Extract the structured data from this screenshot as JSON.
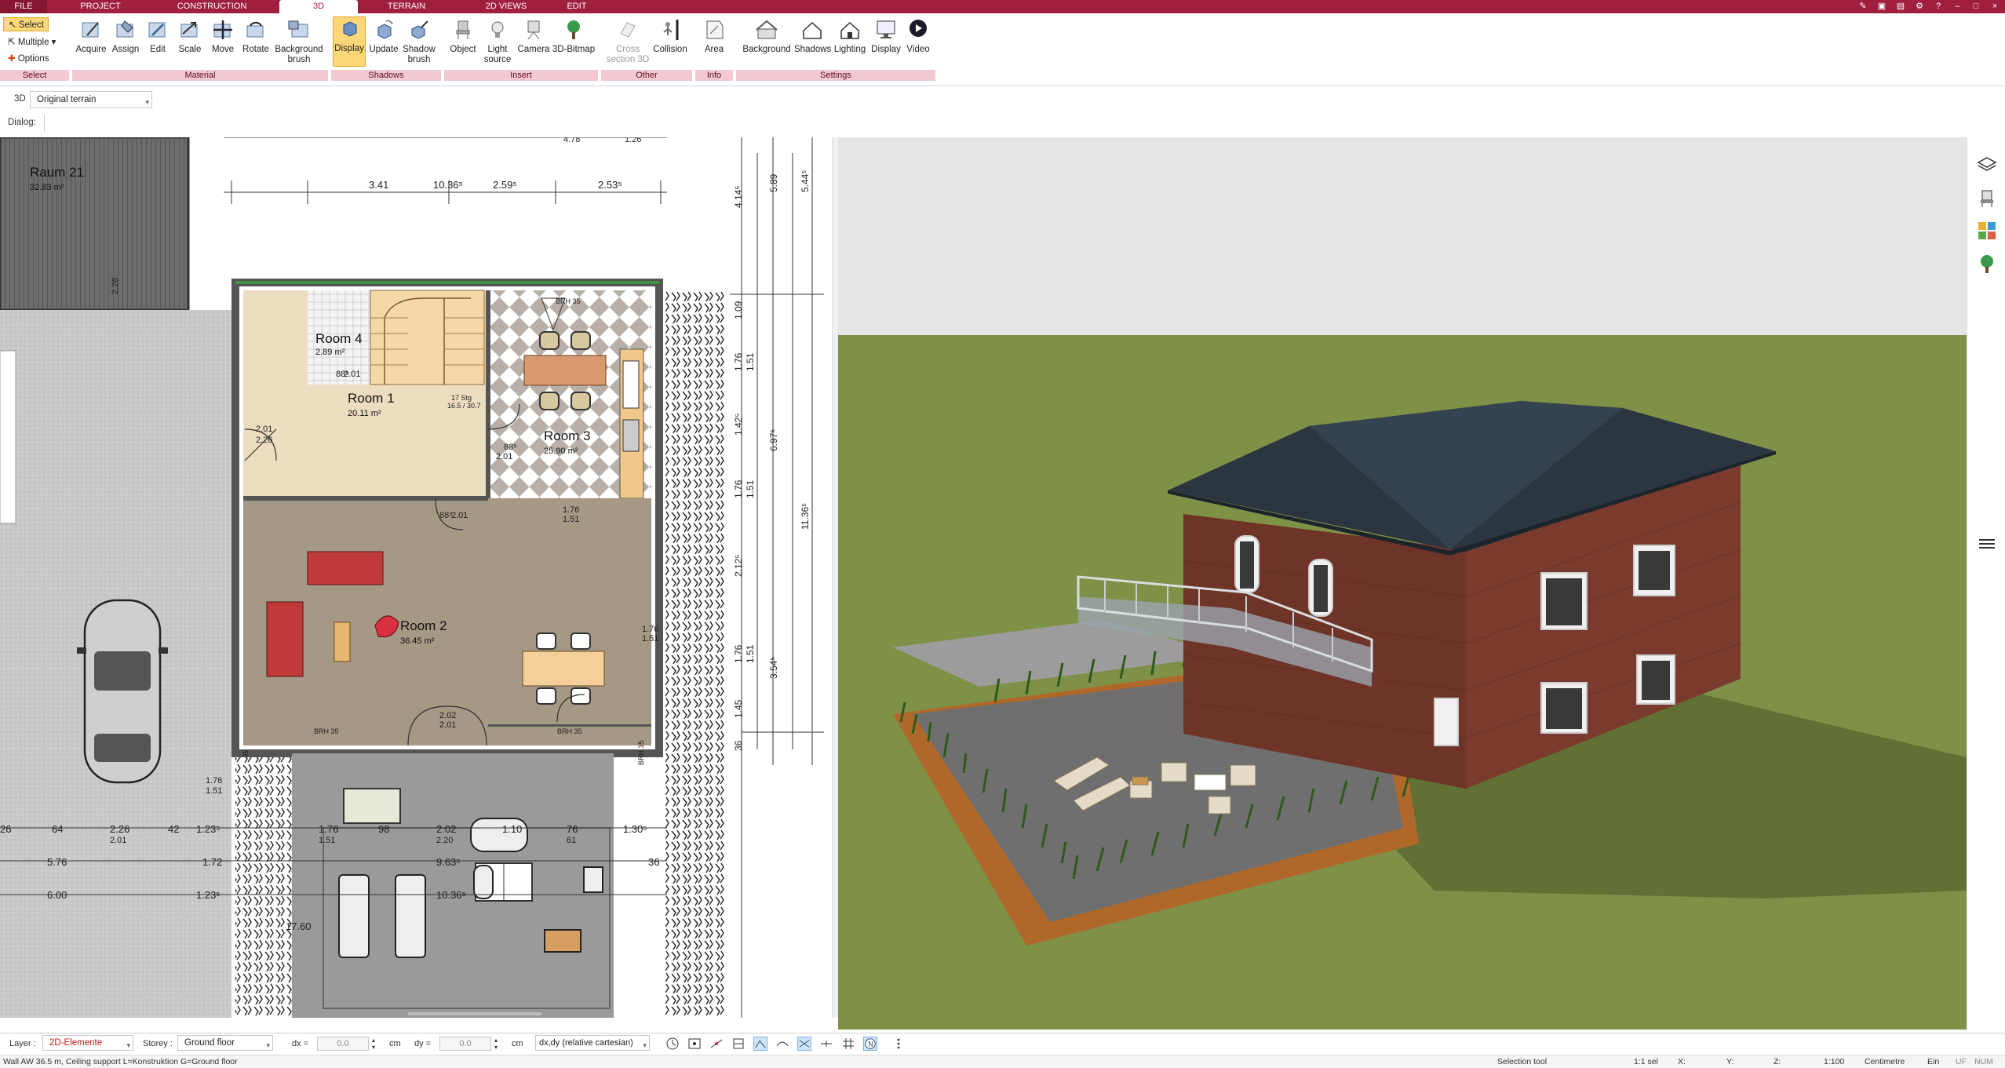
{
  "menu": {
    "file": "FILE",
    "tabs": [
      "PROJECT",
      "CONSTRUCTION",
      "3D",
      "TERRAIN",
      "2D VIEWS",
      "EDIT"
    ],
    "active_tab": "3D"
  },
  "ribbon": {
    "select": {
      "select_label": "Select",
      "multiple_label": "Multiple",
      "options_label": "Options",
      "group": "Select"
    },
    "material": {
      "buttons": [
        "Acquire",
        "Assign",
        "Edit",
        "Scale",
        "Move",
        "Rotate",
        "Background brush"
      ],
      "group": "Material"
    },
    "shadows": {
      "buttons": [
        "Display",
        "Update",
        "Shadow brush"
      ],
      "selected": "Display",
      "group": "Shadows"
    },
    "insert": {
      "buttons": [
        "Object",
        "Light source",
        "Camera",
        "3D-Bitmap"
      ],
      "group": "Insert"
    },
    "other": {
      "buttons": [
        "Cross section 3D",
        "Collision"
      ],
      "disabled": "Cross section 3D",
      "group": "Other"
    },
    "info": {
      "buttons": [
        "Area"
      ],
      "group": "Info"
    },
    "settings": {
      "buttons": [
        "Background",
        "Shadows",
        "Lighting",
        "Display",
        "Video"
      ],
      "group": "Settings"
    }
  },
  "view_bar": {
    "mode": "3D",
    "terrain_select": "Original terrain",
    "dialog_label": "Dialog:"
  },
  "plan": {
    "rooms": [
      {
        "name": "Raum 21",
        "area": "32.83 m²"
      },
      {
        "name": "Room 4",
        "area": "2.89 m²"
      },
      {
        "name": "Room 1",
        "area": "20.11 m²"
      },
      {
        "name": "Room 3",
        "area": "25.90 m²"
      },
      {
        "name": "Room 2",
        "area": "36.45 m²"
      }
    ],
    "dims_top": [
      "3.41",
      "10.36⁵",
      "2.59⁵",
      "2.53⁵",
      "4.78",
      "1.26"
    ],
    "dims_right_inner": [
      "1.09",
      "1.76",
      "1.51",
      "1.42⁵",
      "1.76",
      "1.51",
      "2.12⁵",
      "1.76",
      "1.51",
      "1.45",
      "36"
    ],
    "dims_right_outer": [
      "5.89",
      "4.14⁵",
      "6.97⁵",
      "3.54⁵",
      "11.36⁵",
      "5.44⁵"
    ],
    "dims_misc": [
      "2.01",
      "2.26",
      "88⁵",
      "2.01",
      "88⁵",
      "2.01",
      "88⁵",
      "2.01",
      "17 Stg",
      "16.5 / 30.7",
      "1.76",
      "1.51",
      "2.02",
      "2.01",
      "1.76",
      "1.51",
      "1.76",
      "1.51"
    ],
    "brh_labels": [
      "BRH 35",
      "BRH 35",
      "BRH 35",
      "BRH 35",
      "BRH 35"
    ],
    "dims_bottom_row1": [
      "26",
      "64",
      "2.26",
      "2.01",
      "42",
      "1.23⁵",
      "1.76",
      "1.51",
      "98",
      "2.02",
      "2.20",
      "1.10",
      "76",
      "61",
      "1.30⁵"
    ],
    "dims_bottom_row2": [
      "5.76",
      "1.72",
      "9.63⁵",
      "36"
    ],
    "dims_bottom_row3": [
      "6.00",
      "1.23⁵",
      "10.36⁵",
      "17.60"
    ]
  },
  "statusbar": {
    "layer_label": "Layer :",
    "layer_value": "2D-Elemente",
    "storey_label": "Storey :",
    "storey_value": "Ground floor",
    "dx_label": "dx =",
    "dx_value": "0.0",
    "dx_unit": "cm",
    "dy_label": "dy =",
    "dy_value": "0.0",
    "dy_unit": "cm",
    "coord_mode": "dx,dy (relative cartesian)"
  },
  "statusline": {
    "message": "Wall AW 36.5 m, Ceiling support L=Konstruktion G=Ground floor",
    "tool": "Selection tool",
    "selection": "1:1 sel",
    "x_label": "X:",
    "y_label": "Y:",
    "z_label": "Z:",
    "scale": "1:100",
    "unit": "Centimetre",
    "mode_ein": "Ein",
    "mode_uf": "UF",
    "mode_num": "NUM"
  },
  "colors": {
    "brand": "#a01e3e",
    "group_bar": "#f2c9d1",
    "selected": "#fbd77a",
    "grass": "#7d8f45",
    "brick": "#7a3b2e",
    "roof": "#2b3640"
  }
}
